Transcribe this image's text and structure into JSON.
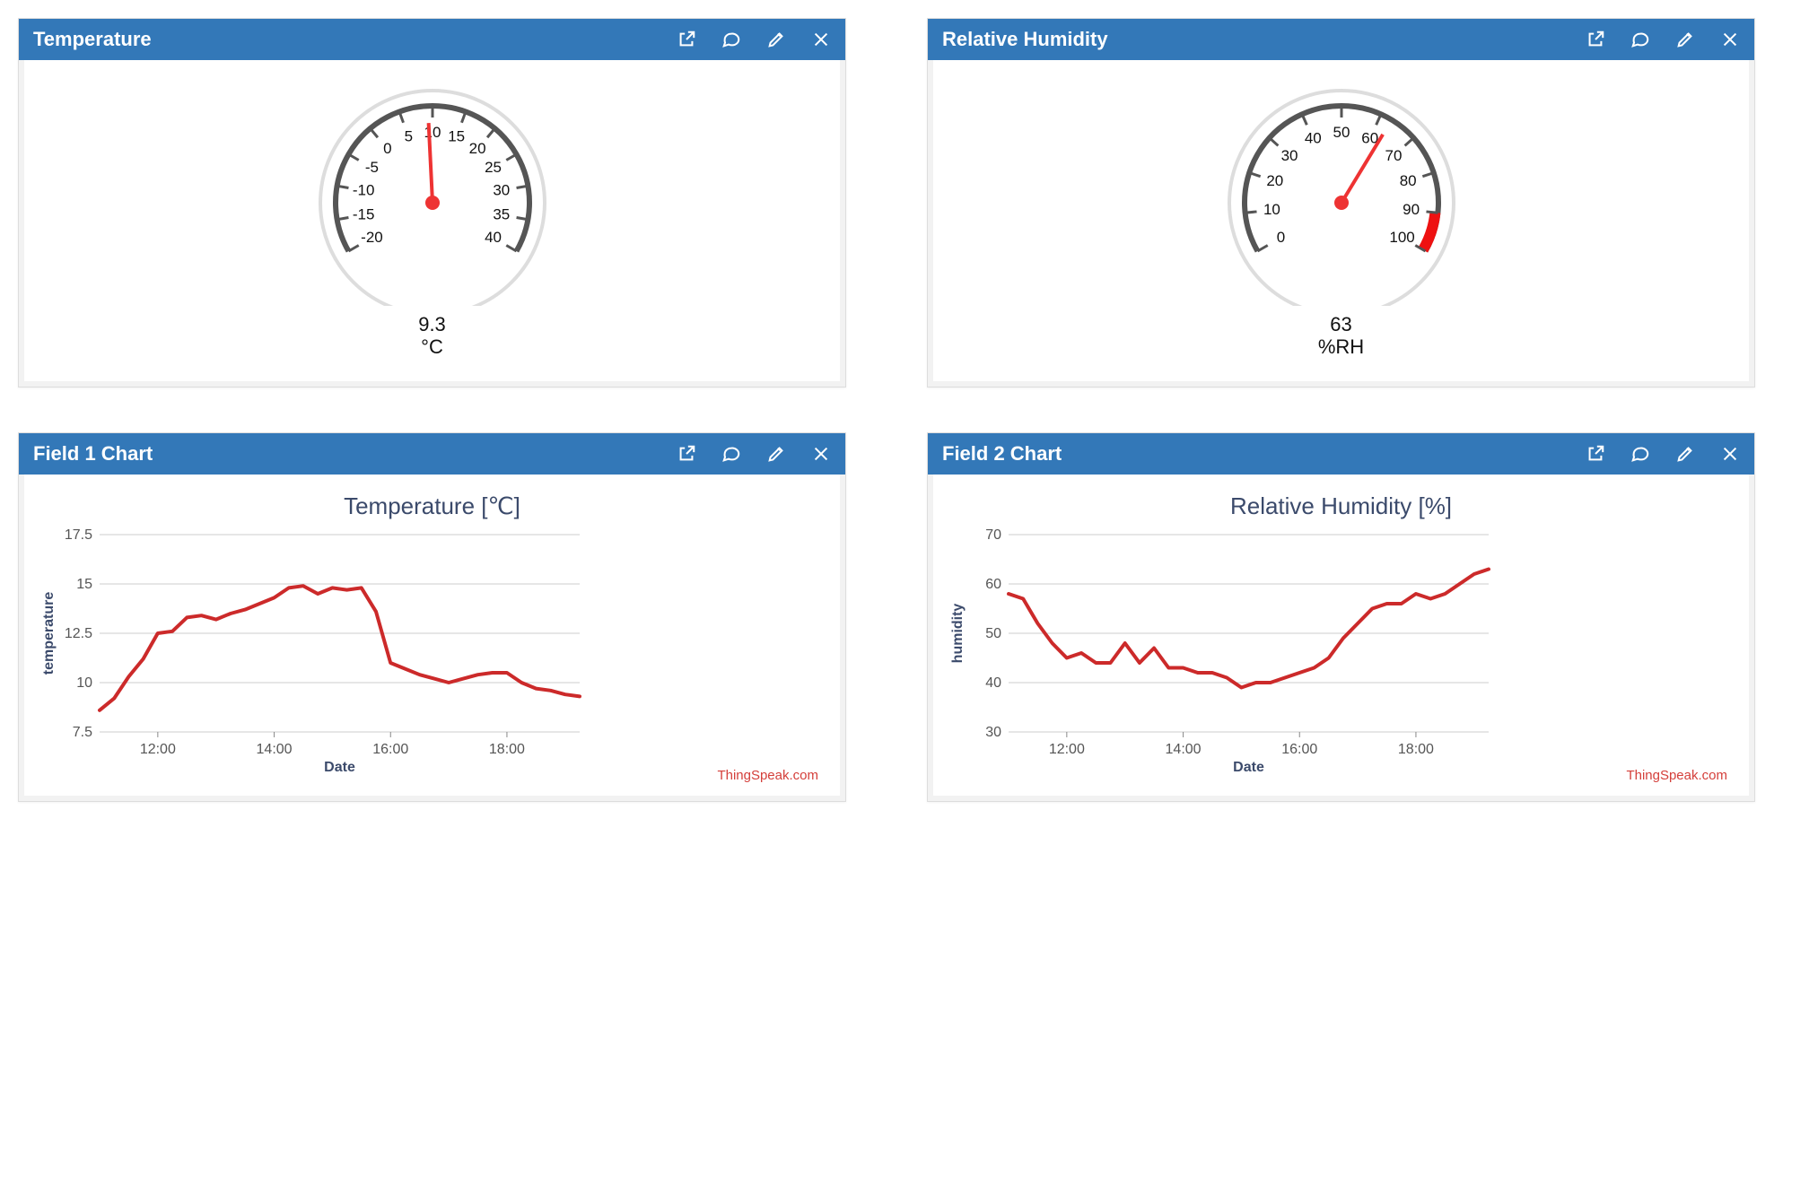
{
  "panels": {
    "tempGauge": {
      "title": "Temperature",
      "value": "9.3",
      "unit": "°C",
      "min": -20,
      "max": 40,
      "ticks": [
        -20,
        -15,
        -10,
        -5,
        0,
        5,
        10,
        15,
        20,
        25,
        30,
        35,
        40
      ]
    },
    "humGauge": {
      "title": "Relative Humidity",
      "value": "63",
      "unit": "%RH",
      "min": 0,
      "max": 100,
      "ticks": [
        0,
        10,
        20,
        30,
        40,
        50,
        60,
        70,
        80,
        90,
        100
      ],
      "redZone": [
        90,
        100
      ]
    },
    "tempChart": {
      "title": "Field 1 Chart",
      "chartTitle": "Temperature [℃]",
      "xlabel": "Date",
      "ylabel": "temperature",
      "credit": "ThingSpeak.com"
    },
    "humChart": {
      "title": "Field 2 Chart",
      "chartTitle": "Relative Humidity [%]",
      "xlabel": "Date",
      "ylabel": "humidity",
      "credit": "ThingSpeak.com"
    }
  },
  "chart_data": [
    {
      "type": "gauge",
      "title": "Temperature",
      "value": 9.3,
      "unit": "°C",
      "range": [
        -20,
        40
      ]
    },
    {
      "type": "gauge",
      "title": "Relative Humidity",
      "value": 63,
      "unit": "%RH",
      "range": [
        0,
        100
      ],
      "redZone": [
        90,
        100
      ]
    },
    {
      "type": "line",
      "title": "Temperature [℃]",
      "xlabel": "Date",
      "ylabel": "temperature",
      "x_ticks": [
        "12:00",
        "14:00",
        "16:00",
        "18:00"
      ],
      "y_ticks": [
        7.5,
        10,
        12.5,
        15,
        17.5
      ],
      "ylim": [
        7.5,
        17.5
      ],
      "series": [
        {
          "name": "temperature",
          "x": [
            "11:00",
            "11:15",
            "11:30",
            "11:45",
            "12:00",
            "12:15",
            "12:30",
            "12:45",
            "13:00",
            "13:15",
            "13:30",
            "13:45",
            "14:00",
            "14:15",
            "14:30",
            "14:45",
            "15:00",
            "15:15",
            "15:30",
            "15:45",
            "16:00",
            "16:15",
            "16:30",
            "16:45",
            "17:00",
            "17:15",
            "17:30",
            "17:45",
            "18:00",
            "18:15",
            "18:30",
            "18:45",
            "19:00",
            "19:15"
          ],
          "values": [
            8.6,
            9.2,
            10.3,
            11.2,
            12.5,
            12.6,
            13.3,
            13.4,
            13.2,
            13.5,
            13.7,
            14.0,
            14.3,
            14.8,
            14.9,
            14.5,
            14.8,
            14.7,
            14.8,
            13.6,
            11.0,
            10.7,
            10.4,
            10.2,
            10.0,
            10.2,
            10.4,
            10.5,
            10.5,
            10.0,
            9.7,
            9.6,
            9.4,
            9.3
          ]
        }
      ],
      "credit": "ThingSpeak.com"
    },
    {
      "type": "line",
      "title": "Relative Humidity [%]",
      "xlabel": "Date",
      "ylabel": "humidity",
      "x_ticks": [
        "12:00",
        "14:00",
        "16:00",
        "18:00"
      ],
      "y_ticks": [
        30,
        40,
        50,
        60,
        70
      ],
      "ylim": [
        30,
        70
      ],
      "series": [
        {
          "name": "humidity",
          "x": [
            "11:00",
            "11:15",
            "11:30",
            "11:45",
            "12:00",
            "12:15",
            "12:30",
            "12:45",
            "13:00",
            "13:15",
            "13:30",
            "13:45",
            "14:00",
            "14:15",
            "14:30",
            "14:45",
            "15:00",
            "15:15",
            "15:30",
            "15:45",
            "16:00",
            "16:15",
            "16:30",
            "16:45",
            "17:00",
            "17:15",
            "17:30",
            "17:45",
            "18:00",
            "18:15",
            "18:30",
            "18:45",
            "19:00",
            "19:15"
          ],
          "values": [
            58,
            57,
            52,
            48,
            45,
            46,
            44,
            44,
            48,
            44,
            47,
            43,
            43,
            42,
            42,
            41,
            39,
            40,
            40,
            41,
            42,
            43,
            45,
            49,
            52,
            55,
            56,
            56,
            58,
            57,
            58,
            60,
            62,
            63
          ]
        }
      ],
      "credit": "ThingSpeak.com"
    }
  ]
}
